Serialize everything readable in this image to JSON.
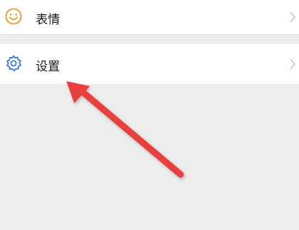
{
  "menu": {
    "items": [
      {
        "label": "表情",
        "icon": "smiley-face-icon",
        "icon_color": "#e9a23b"
      },
      {
        "label": "设置",
        "icon": "gear-icon",
        "icon_color": "#3b7bd8"
      }
    ]
  },
  "annotation": {
    "type": "arrow",
    "color": "#e8403e"
  },
  "colors": {
    "background": "#ededed",
    "row": "#ffffff",
    "chevron": "#c8c8c8"
  }
}
